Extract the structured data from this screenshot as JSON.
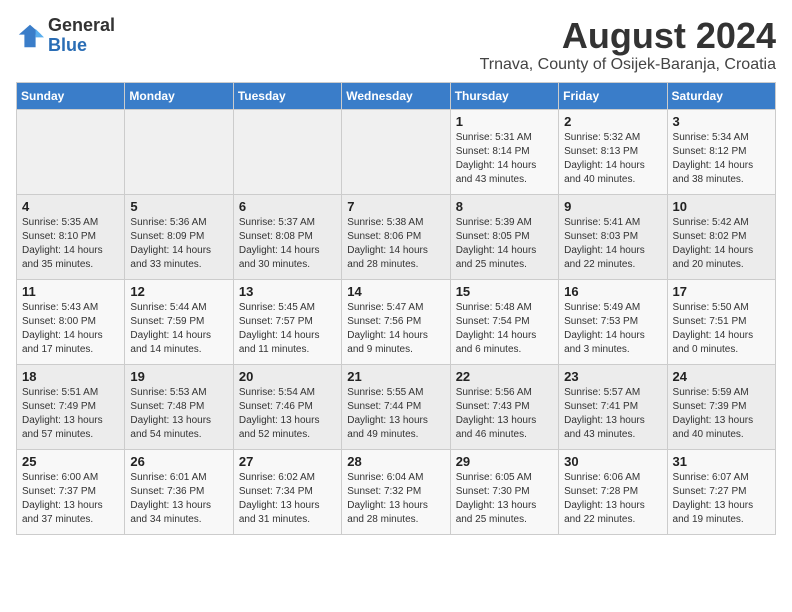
{
  "header": {
    "logo_general": "General",
    "logo_blue": "Blue",
    "month_year": "August 2024",
    "location": "Trnava, County of Osijek-Baranja, Croatia"
  },
  "weekdays": [
    "Sunday",
    "Monday",
    "Tuesday",
    "Wednesday",
    "Thursday",
    "Friday",
    "Saturday"
  ],
  "weeks": [
    [
      {
        "day": "",
        "info": ""
      },
      {
        "day": "",
        "info": ""
      },
      {
        "day": "",
        "info": ""
      },
      {
        "day": "",
        "info": ""
      },
      {
        "day": "1",
        "info": "Sunrise: 5:31 AM\nSunset: 8:14 PM\nDaylight: 14 hours\nand 43 minutes."
      },
      {
        "day": "2",
        "info": "Sunrise: 5:32 AM\nSunset: 8:13 PM\nDaylight: 14 hours\nand 40 minutes."
      },
      {
        "day": "3",
        "info": "Sunrise: 5:34 AM\nSunset: 8:12 PM\nDaylight: 14 hours\nand 38 minutes."
      }
    ],
    [
      {
        "day": "4",
        "info": "Sunrise: 5:35 AM\nSunset: 8:10 PM\nDaylight: 14 hours\nand 35 minutes."
      },
      {
        "day": "5",
        "info": "Sunrise: 5:36 AM\nSunset: 8:09 PM\nDaylight: 14 hours\nand 33 minutes."
      },
      {
        "day": "6",
        "info": "Sunrise: 5:37 AM\nSunset: 8:08 PM\nDaylight: 14 hours\nand 30 minutes."
      },
      {
        "day": "7",
        "info": "Sunrise: 5:38 AM\nSunset: 8:06 PM\nDaylight: 14 hours\nand 28 minutes."
      },
      {
        "day": "8",
        "info": "Sunrise: 5:39 AM\nSunset: 8:05 PM\nDaylight: 14 hours\nand 25 minutes."
      },
      {
        "day": "9",
        "info": "Sunrise: 5:41 AM\nSunset: 8:03 PM\nDaylight: 14 hours\nand 22 minutes."
      },
      {
        "day": "10",
        "info": "Sunrise: 5:42 AM\nSunset: 8:02 PM\nDaylight: 14 hours\nand 20 minutes."
      }
    ],
    [
      {
        "day": "11",
        "info": "Sunrise: 5:43 AM\nSunset: 8:00 PM\nDaylight: 14 hours\nand 17 minutes."
      },
      {
        "day": "12",
        "info": "Sunrise: 5:44 AM\nSunset: 7:59 PM\nDaylight: 14 hours\nand 14 minutes."
      },
      {
        "day": "13",
        "info": "Sunrise: 5:45 AM\nSunset: 7:57 PM\nDaylight: 14 hours\nand 11 minutes."
      },
      {
        "day": "14",
        "info": "Sunrise: 5:47 AM\nSunset: 7:56 PM\nDaylight: 14 hours\nand 9 minutes."
      },
      {
        "day": "15",
        "info": "Sunrise: 5:48 AM\nSunset: 7:54 PM\nDaylight: 14 hours\nand 6 minutes."
      },
      {
        "day": "16",
        "info": "Sunrise: 5:49 AM\nSunset: 7:53 PM\nDaylight: 14 hours\nand 3 minutes."
      },
      {
        "day": "17",
        "info": "Sunrise: 5:50 AM\nSunset: 7:51 PM\nDaylight: 14 hours\nand 0 minutes."
      }
    ],
    [
      {
        "day": "18",
        "info": "Sunrise: 5:51 AM\nSunset: 7:49 PM\nDaylight: 13 hours\nand 57 minutes."
      },
      {
        "day": "19",
        "info": "Sunrise: 5:53 AM\nSunset: 7:48 PM\nDaylight: 13 hours\nand 54 minutes."
      },
      {
        "day": "20",
        "info": "Sunrise: 5:54 AM\nSunset: 7:46 PM\nDaylight: 13 hours\nand 52 minutes."
      },
      {
        "day": "21",
        "info": "Sunrise: 5:55 AM\nSunset: 7:44 PM\nDaylight: 13 hours\nand 49 minutes."
      },
      {
        "day": "22",
        "info": "Sunrise: 5:56 AM\nSunset: 7:43 PM\nDaylight: 13 hours\nand 46 minutes."
      },
      {
        "day": "23",
        "info": "Sunrise: 5:57 AM\nSunset: 7:41 PM\nDaylight: 13 hours\nand 43 minutes."
      },
      {
        "day": "24",
        "info": "Sunrise: 5:59 AM\nSunset: 7:39 PM\nDaylight: 13 hours\nand 40 minutes."
      }
    ],
    [
      {
        "day": "25",
        "info": "Sunrise: 6:00 AM\nSunset: 7:37 PM\nDaylight: 13 hours\nand 37 minutes."
      },
      {
        "day": "26",
        "info": "Sunrise: 6:01 AM\nSunset: 7:36 PM\nDaylight: 13 hours\nand 34 minutes."
      },
      {
        "day": "27",
        "info": "Sunrise: 6:02 AM\nSunset: 7:34 PM\nDaylight: 13 hours\nand 31 minutes."
      },
      {
        "day": "28",
        "info": "Sunrise: 6:04 AM\nSunset: 7:32 PM\nDaylight: 13 hours\nand 28 minutes."
      },
      {
        "day": "29",
        "info": "Sunrise: 6:05 AM\nSunset: 7:30 PM\nDaylight: 13 hours\nand 25 minutes."
      },
      {
        "day": "30",
        "info": "Sunrise: 6:06 AM\nSunset: 7:28 PM\nDaylight: 13 hours\nand 22 minutes."
      },
      {
        "day": "31",
        "info": "Sunrise: 6:07 AM\nSunset: 7:27 PM\nDaylight: 13 hours\nand 19 minutes."
      }
    ]
  ]
}
